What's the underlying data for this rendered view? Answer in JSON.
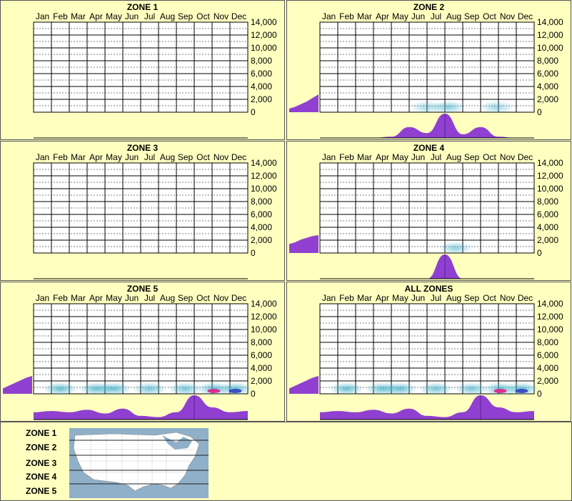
{
  "months": [
    "Jan",
    "Feb",
    "Mar",
    "Apr",
    "May",
    "Jun",
    "Jul",
    "Aug",
    "Sep",
    "Oct",
    "Nov",
    "Dec"
  ],
  "y_ticks": [
    "14,000",
    "12,000",
    "10,000",
    "8,000",
    "6,000",
    "4,000",
    "2,000",
    "0"
  ],
  "colors": {
    "background": "#ffffc0",
    "fill": "#9040d0",
    "heat": "#40b0c8"
  },
  "chart_data": [
    {
      "type": "heatmap",
      "title": "ZONE 1",
      "ylim": [
        0,
        14000
      ],
      "left_curve": [],
      "bottom_curve": [],
      "heat_spots": []
    },
    {
      "type": "heatmap",
      "title": "ZONE 2",
      "ylim": [
        0,
        14000
      ],
      "left_curve": [
        0.2,
        0.3,
        0.45,
        0.6,
        0.8,
        1.0
      ],
      "bottom_curve": [
        0,
        0,
        0,
        0,
        0.05,
        0.45,
        0.2,
        1.0,
        0.15,
        0.45,
        0.05,
        0,
        0
      ],
      "heat_spots": [
        {
          "month": 5.5,
          "level": 0.2
        },
        {
          "month": 6.7,
          "level": 0.4
        },
        {
          "month": 9.4,
          "level": 0.25
        }
      ]
    },
    {
      "type": "heatmap",
      "title": "ZONE 3",
      "ylim": [
        0,
        14000
      ],
      "left_curve": [],
      "bottom_curve": [],
      "heat_spots": []
    },
    {
      "type": "heatmap",
      "title": "ZONE 4",
      "ylim": [
        0,
        14000
      ],
      "left_curve": [
        0.5,
        0.6,
        0.75,
        0.85,
        0.95,
        1.0
      ],
      "bottom_curve": [
        0,
        0,
        0,
        0,
        0,
        0,
        0,
        1.0,
        0,
        0,
        0,
        0,
        0
      ],
      "heat_spots": [
        {
          "month": 7.1,
          "level": 0.35
        }
      ]
    },
    {
      "type": "heatmap",
      "title": "ZONE 5",
      "ylim": [
        0,
        14000
      ],
      "left_curve": [
        0.3,
        0.45,
        0.6,
        0.75,
        0.9,
        1.0
      ],
      "bottom_curve": [
        0.3,
        0.35,
        0.3,
        0.4,
        0.25,
        0.45,
        0.15,
        0.1,
        0.3,
        1.0,
        0.5,
        0.3,
        0.35
      ],
      "heat_spots": [
        {
          "month": 1,
          "level": 0.6
        },
        {
          "month": 3,
          "level": 0.6
        },
        {
          "month": 4,
          "level": 0.6
        },
        {
          "month": 6,
          "level": 0.5
        },
        {
          "month": 8,
          "level": 0.5
        },
        {
          "month": 9.6,
          "level": 1.0
        },
        {
          "month": 10.8,
          "level": 0.8
        }
      ]
    },
    {
      "type": "heatmap",
      "title": "ALL ZONES",
      "ylim": [
        0,
        14000
      ],
      "left_curve": [
        0.3,
        0.45,
        0.6,
        0.75,
        0.9,
        1.0
      ],
      "bottom_curve": [
        0.3,
        0.35,
        0.3,
        0.4,
        0.25,
        0.45,
        0.15,
        0.1,
        0.3,
        1.0,
        0.5,
        0.3,
        0.35
      ],
      "heat_spots": [
        {
          "month": 1,
          "level": 0.6
        },
        {
          "month": 3,
          "level": 0.6
        },
        {
          "month": 4,
          "level": 0.6
        },
        {
          "month": 6,
          "level": 0.5
        },
        {
          "month": 8,
          "level": 0.5
        },
        {
          "month": 9.6,
          "level": 1.0
        },
        {
          "month": 10.8,
          "level": 0.8
        }
      ]
    }
  ],
  "legend": {
    "zones": [
      "ZONE 1",
      "ZONE 2",
      "ZONE 3",
      "ZONE 4",
      "ZONE 5"
    ]
  }
}
